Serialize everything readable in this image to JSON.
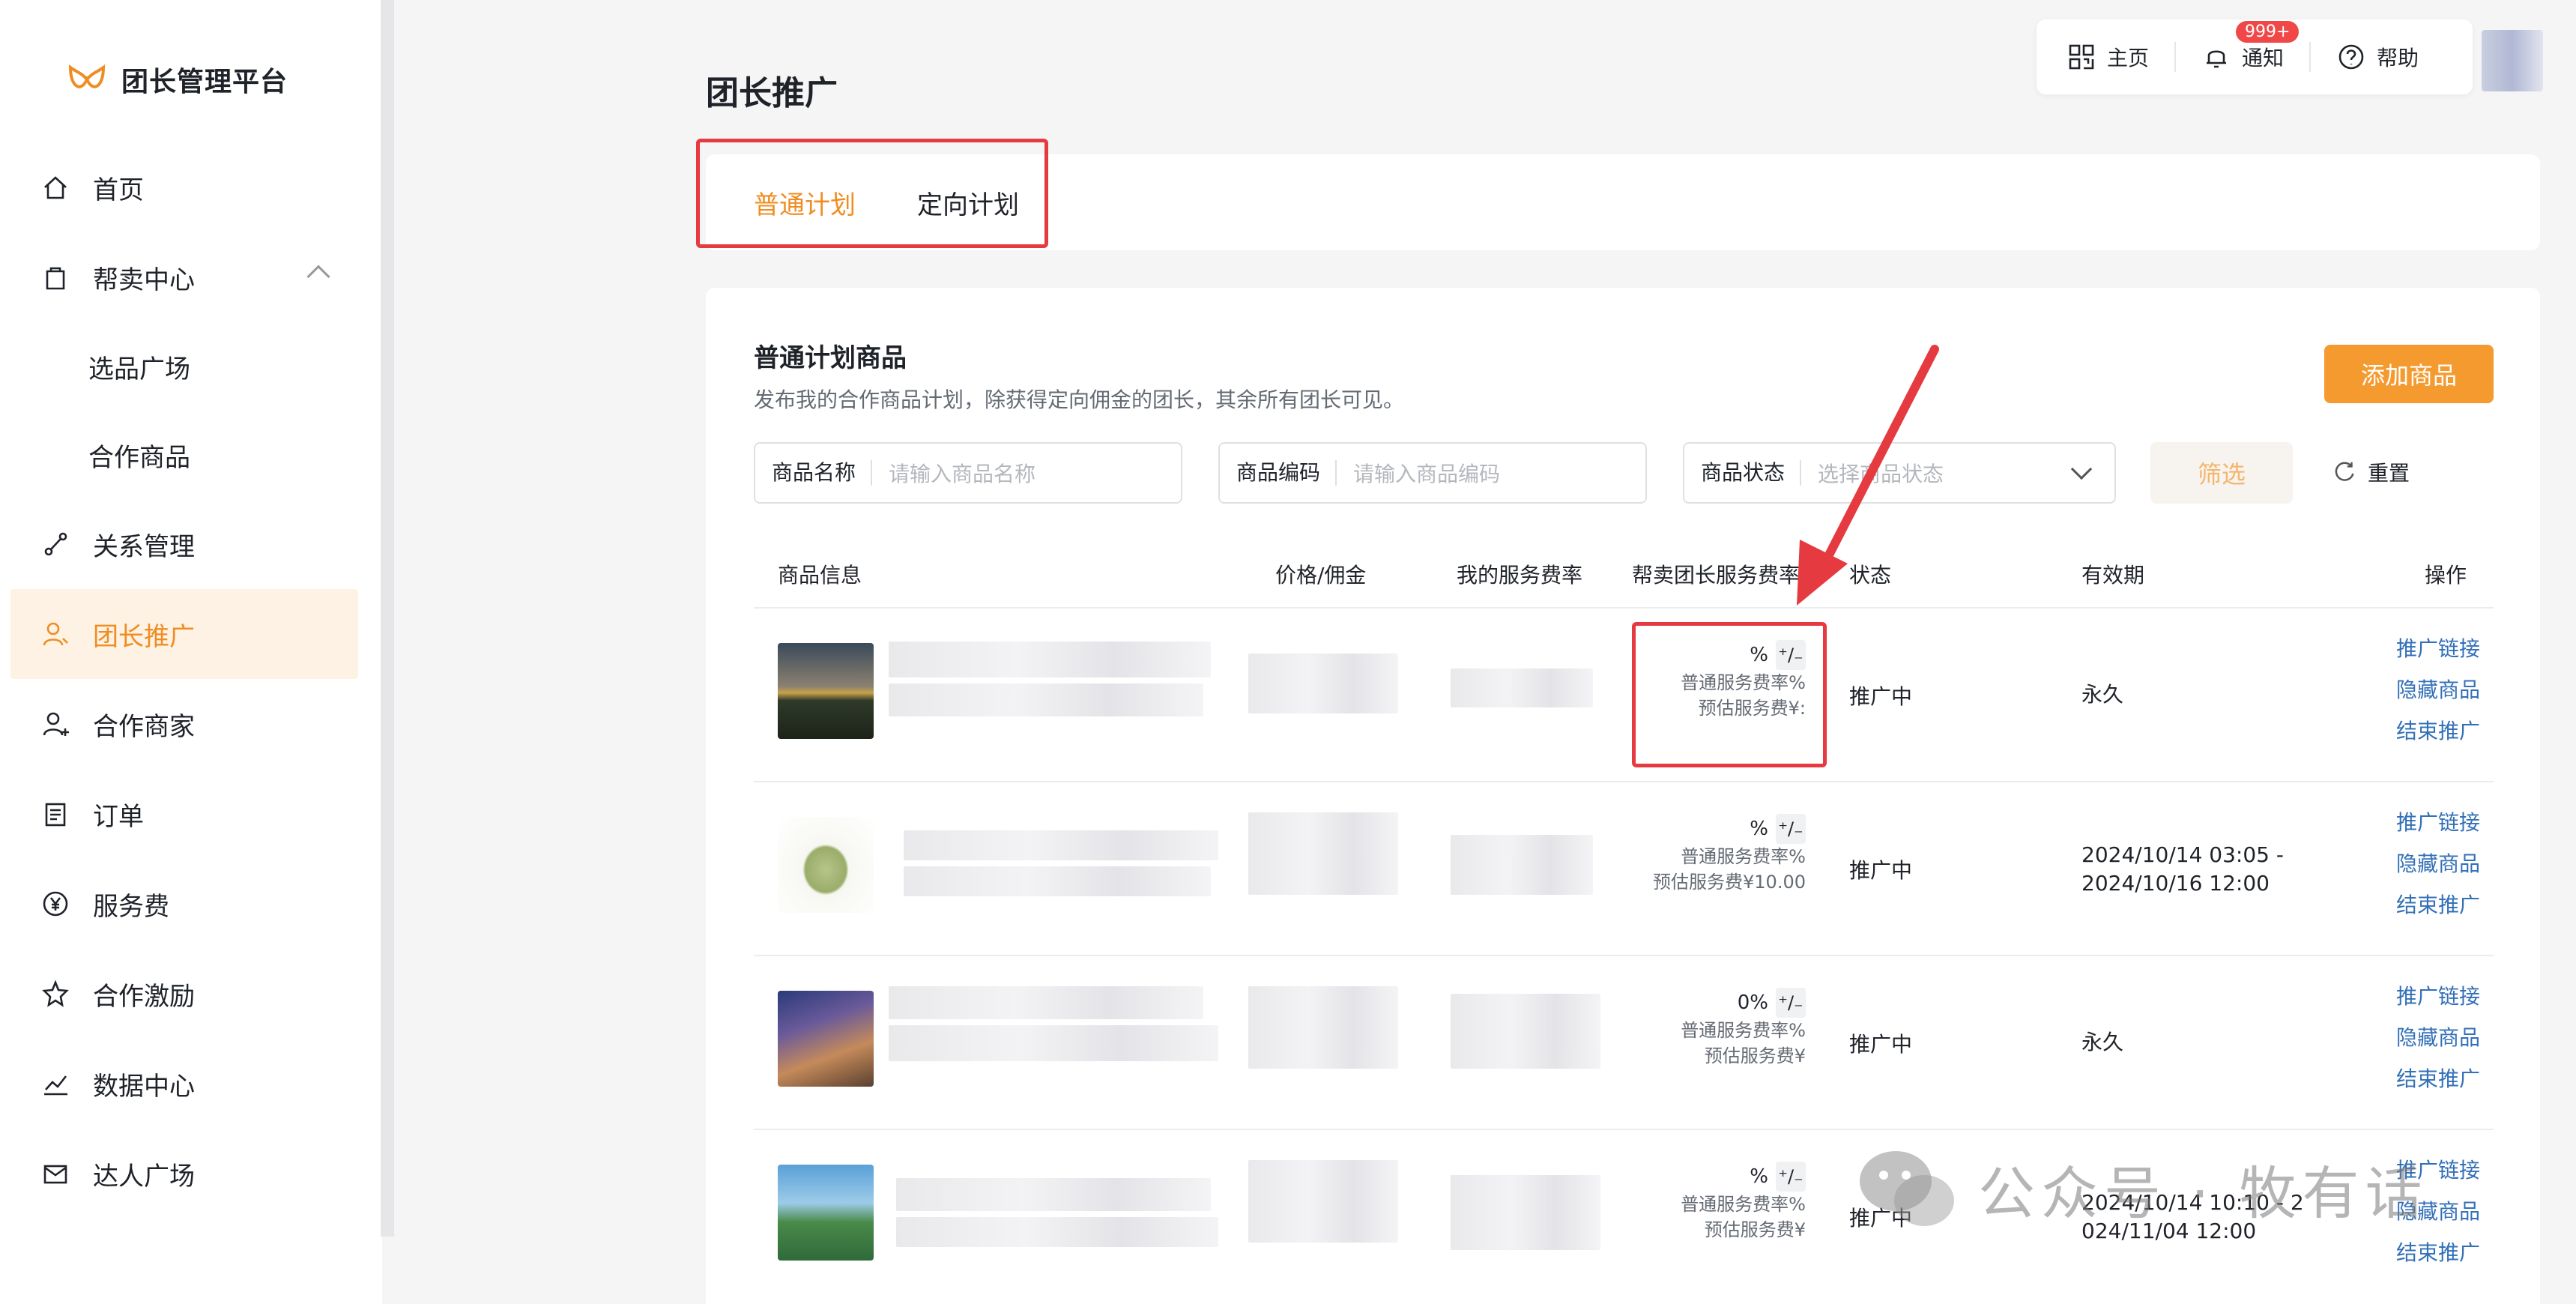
{
  "app": {
    "title": "团长管理平台",
    "brand_color": "#f08d22"
  },
  "sidebar": {
    "items": [
      {
        "label": "首页",
        "icon": "home-icon"
      },
      {
        "label": "帮卖中心",
        "icon": "shopping-bag-icon"
      },
      {
        "label": "选品广场"
      },
      {
        "label": "合作商品"
      },
      {
        "label": "关系管理",
        "icon": "relation-icon"
      },
      {
        "label": "团长推广",
        "icon": "user-promote-icon",
        "active": true
      },
      {
        "label": "合作商家",
        "icon": "user-add-icon"
      },
      {
        "label": "订单",
        "icon": "order-icon"
      },
      {
        "label": "服务费",
        "icon": "yen-icon"
      },
      {
        "label": "合作激励",
        "icon": "star-icon"
      },
      {
        "label": "数据中心",
        "icon": "chart-icon"
      },
      {
        "label": "达人广场",
        "icon": "mail-icon"
      }
    ]
  },
  "topbar": {
    "home_label": "主页",
    "notify_label": "通知",
    "notify_badge": "999+",
    "help_label": "帮助"
  },
  "page": {
    "title": "团长推广",
    "tabs": [
      "普通计划",
      "定向计划"
    ],
    "active_tab": "普通计划"
  },
  "card": {
    "title": "普通计划商品",
    "subtitle": "发布我的合作商品计划，除获得定向佣金的团长，其余所有团长可见。",
    "add_button": "添加商品"
  },
  "filters": {
    "name_label": "商品名称",
    "name_placeholder": "请输入商品名称",
    "code_label": "商品编码",
    "code_placeholder": "请输入商品编码",
    "status_label": "商品状态",
    "status_placeholder": "选择商品状态",
    "screen_button": "筛选",
    "reset_button": "重置"
  },
  "table": {
    "columns": [
      "商品信息",
      "价格/佣金",
      "我的服务费率",
      "帮卖团长服务费率",
      "状态",
      "有效期",
      "操作"
    ],
    "rows": [
      {
        "rate_top": "%",
        "rate_line1": "普通服务费率%",
        "rate_line2": "预估服务费¥:",
        "status": "推广中",
        "valid1": "永久",
        "valid2": ""
      },
      {
        "rate_top": "%",
        "rate_line1": "普通服务费率%",
        "rate_line2": "预估服务费¥10.00",
        "status": "推广中",
        "valid1": "2024/10/14 03:05 -",
        "valid2": "2024/10/16 12:00"
      },
      {
        "rate_top": "0%",
        "rate_line1": "普通服务费率%",
        "rate_line2": "预估服务费¥",
        "status": "推广中",
        "valid1": "永久",
        "valid2": ""
      },
      {
        "rate_top": "%",
        "rate_line1": "普通服务费率%",
        "rate_line2": "预估服务费¥",
        "status": "推广中",
        "valid1": "2024/10/14 10:10 - 2",
        "valid2": "024/11/04 12:00"
      }
    ],
    "ops": [
      "推广链接",
      "隐藏商品",
      "结束推广"
    ],
    "edit_glyph": "⁺∕₋"
  },
  "watermark": {
    "text": "公众号 · 牧有话"
  }
}
